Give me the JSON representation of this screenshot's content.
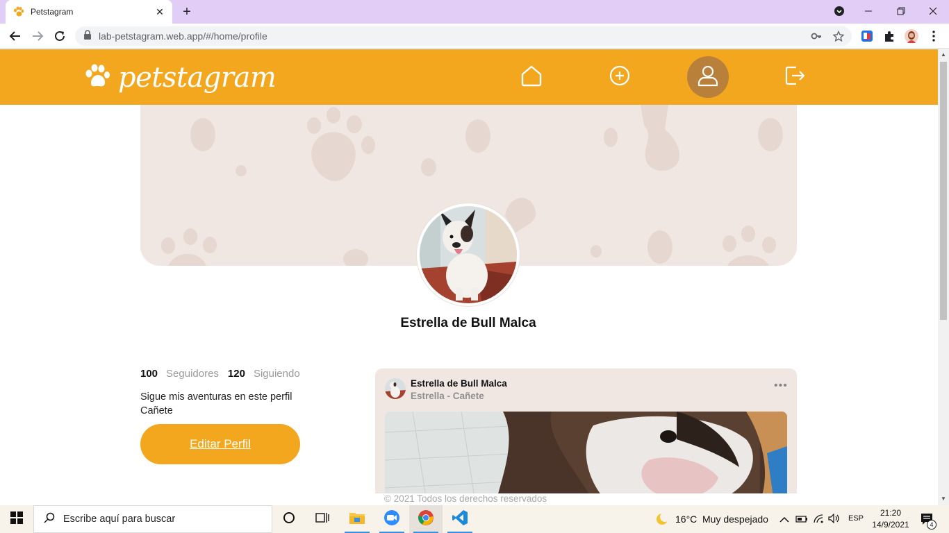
{
  "browser": {
    "tab_title": "Petstagram",
    "url": "lab-petstagram.web.app/#/home/profile"
  },
  "app": {
    "logo_text": "petstagram",
    "nav": [
      {
        "name": "home",
        "icon": "home-icon"
      },
      {
        "name": "add-post",
        "icon": "plus-circle-icon"
      },
      {
        "name": "profile",
        "icon": "user-icon",
        "active": true
      },
      {
        "name": "logout",
        "icon": "logout-icon"
      }
    ],
    "colors": {
      "primary": "#f2a71e",
      "active_nav": "#b8803a",
      "card_bg": "#f0e7e3"
    }
  },
  "profile": {
    "name": "Estrella de Bull Malca",
    "followers_count": "100",
    "followers_label": "Seguidores",
    "following_count": "120",
    "following_label": "Siguiendo",
    "bio_line1": "Sigue mis aventuras en este perfil",
    "bio_line2": "Cañete",
    "edit_button": "Editar Perfil"
  },
  "post": {
    "user": "Estrella de Bull Malca",
    "location": "Estrella - Cañete",
    "more": "•••"
  },
  "footer": {
    "text": "© 2021 Todos los derechos reservados"
  },
  "taskbar": {
    "search_placeholder": "Escribe aquí para buscar",
    "weather_temp": "16°C",
    "weather_desc": "Muy despejado",
    "language": "ESP",
    "time": "21:20",
    "date": "14/9/2021",
    "notifications": "4"
  }
}
